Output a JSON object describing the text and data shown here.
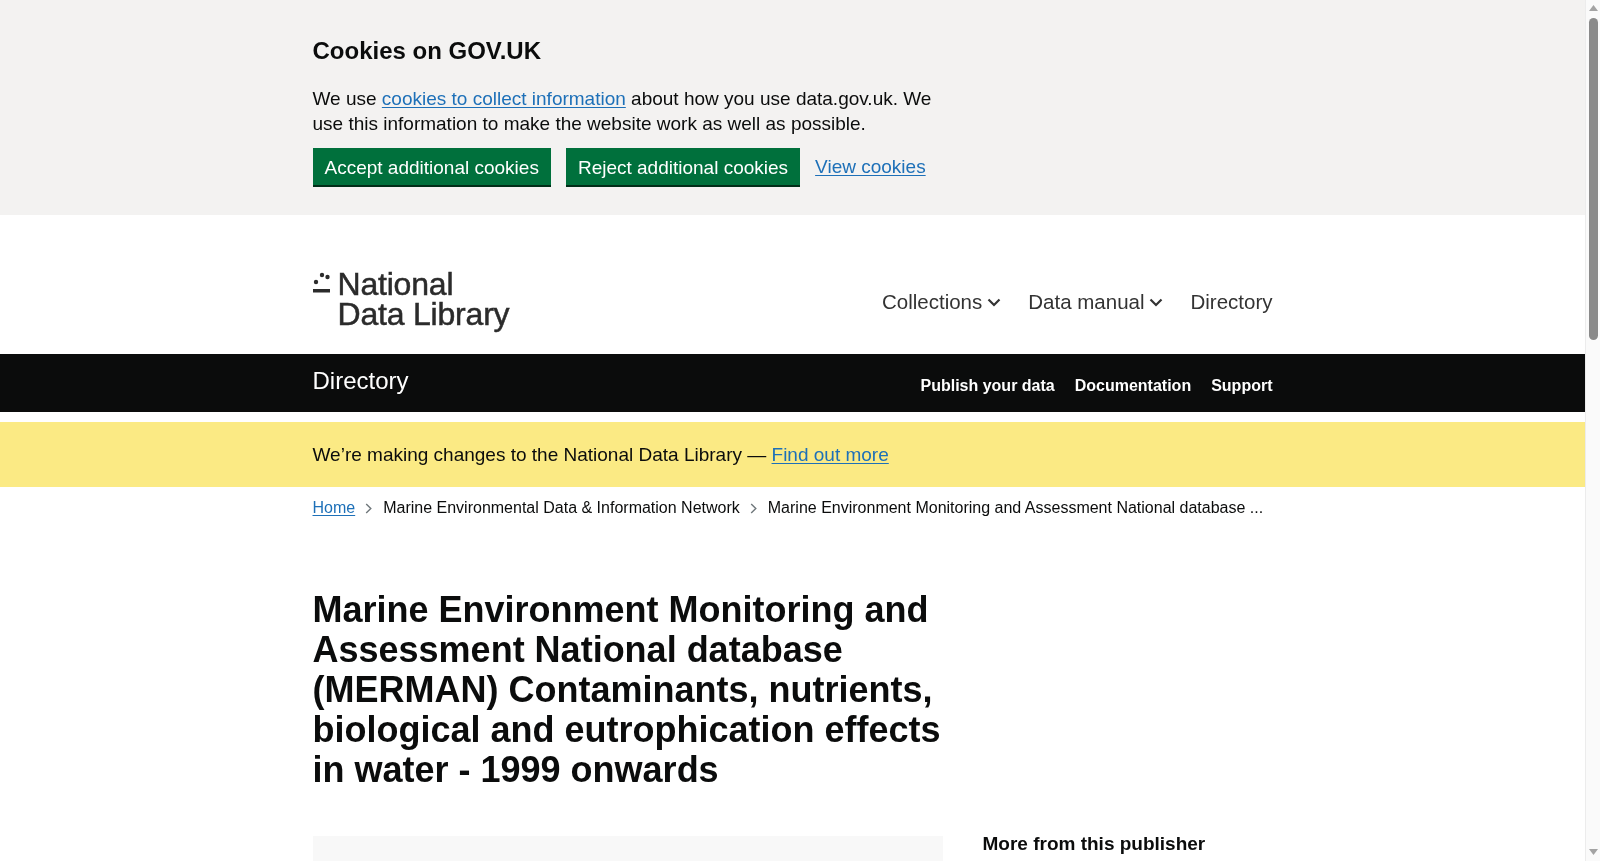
{
  "cookie_banner": {
    "title": "Cookies on GOV.UK",
    "text_before": "We use ",
    "link": "cookies to collect information",
    "text_after": " about how you use data.gov.uk. We use this information to make the website work as well as possible.",
    "actions": [
      {
        "kind": "button",
        "label": "Accept additional cookies"
      },
      {
        "kind": "button",
        "label": "Reject additional cookies"
      },
      {
        "kind": "link",
        "label": "View cookies"
      }
    ]
  },
  "header": {
    "logo": {
      "lines": [
        "National",
        "Data Library"
      ]
    },
    "nav": [
      {
        "label": "Collections",
        "dropdown": true
      },
      {
        "label": "Data manual",
        "dropdown": true
      },
      {
        "label": "Directory",
        "dropdown": false
      }
    ]
  },
  "service_bar": {
    "title": "Directory",
    "links": [
      "Publish your data",
      "Documentation",
      "Support"
    ]
  },
  "notice": {
    "text": "We’re making changes to the National Data Library — ",
    "link": "Find out more"
  },
  "breadcrumbs": [
    {
      "kind": "link",
      "label": "Home"
    },
    {
      "kind": "text",
      "label": "Marine Environmental Data & Information Network"
    },
    {
      "kind": "text",
      "label": "Marine Environment Monitoring and Assessment National database ..."
    }
  ],
  "dataset": {
    "title": "Marine Environment Monitoring and Assessment National database (MERMAN) Contaminants, nutrients, biological and eutrophication effects in water - 1999 onwards"
  },
  "sidebar": {
    "heading": "More from this publisher"
  }
}
